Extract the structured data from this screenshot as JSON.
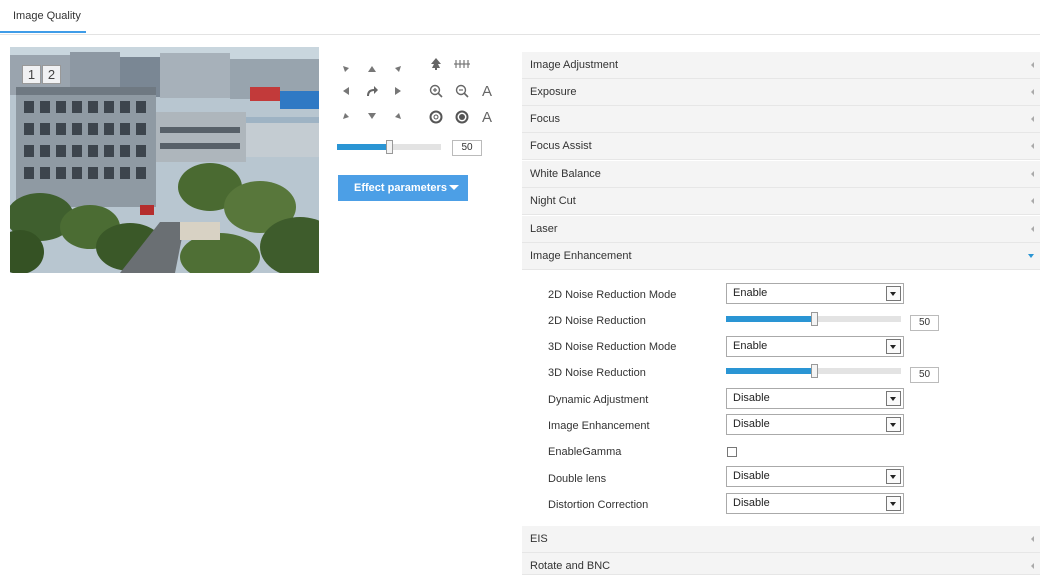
{
  "tab": {
    "label": "Image Quality"
  },
  "preview": {
    "window_splits": [
      "1",
      "2"
    ]
  },
  "ptz": {
    "speed_value": "50",
    "speed_fraction": 0.5,
    "zoom_label": "A",
    "iris_label": "A",
    "effect_button_label": "Effect parameters"
  },
  "sections": {
    "image_adjustment": "Image Adjustment",
    "exposure": "Exposure",
    "focus": "Focus",
    "focus_assist": "Focus Assist",
    "white_balance": "White Balance",
    "night_cut": "Night Cut",
    "laser": "Laser",
    "image_enhancement": "Image Enhancement",
    "eis": "EIS",
    "rotate_bnc": "Rotate and BNC"
  },
  "enhancement": {
    "nr2d_mode": {
      "label": "2D Noise Reduction Mode",
      "value": "Enable"
    },
    "nr2d": {
      "label": "2D Noise Reduction",
      "value": "50",
      "fraction": 0.5
    },
    "nr3d_mode": {
      "label": "3D Noise Reduction Mode",
      "value": "Enable"
    },
    "nr3d": {
      "label": "3D Noise Reduction",
      "value": "50",
      "fraction": 0.5
    },
    "dynamic_adjustment": {
      "label": "Dynamic Adjustment",
      "value": "Disable"
    },
    "image_enhancement": {
      "label": "Image Enhancement",
      "value": "Disable"
    },
    "enable_gamma": {
      "label": "EnableGamma",
      "checked": false
    },
    "double_lens": {
      "label": "Double lens",
      "value": "Disable"
    },
    "distortion_correction": {
      "label": "Distortion Correction",
      "value": "Disable"
    }
  },
  "colors": {
    "accent": "#2a95d4",
    "button": "#4c9fe6",
    "header_bg": "#f4f4f4"
  }
}
